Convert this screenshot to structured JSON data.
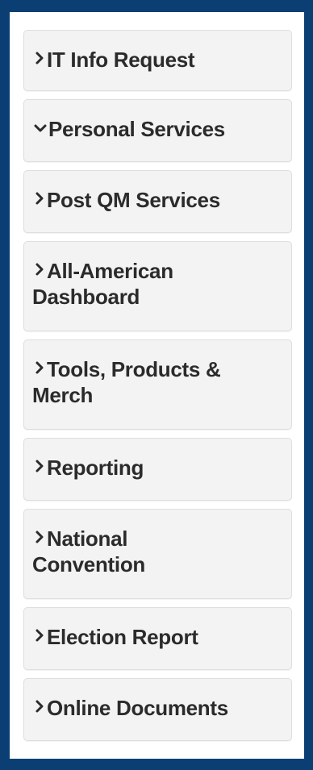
{
  "nav": {
    "items": [
      {
        "label": "IT Info Request",
        "icon": "chevron-right-icon",
        "expanded": false
      },
      {
        "label": "Personal Services",
        "icon": "chevron-down-icon",
        "expanded": true
      },
      {
        "label": "Post QM Services",
        "icon": "chevron-right-icon",
        "expanded": false
      },
      {
        "label": "All-American Dashboard",
        "icon": "chevron-right-icon",
        "expanded": false
      },
      {
        "label": "Tools, Products & Merch",
        "icon": "chevron-right-icon",
        "expanded": false
      },
      {
        "label": "Reporting",
        "icon": "chevron-right-icon",
        "expanded": false
      },
      {
        "label": "National Convention",
        "icon": "chevron-right-icon",
        "expanded": false
      },
      {
        "label": "Election Report",
        "icon": "chevron-right-icon",
        "expanded": false
      },
      {
        "label": "Online Documents",
        "icon": "chevron-right-icon",
        "expanded": false
      }
    ]
  },
  "colors": {
    "frame": "#0b3f73",
    "item_background": "#f3f3f3",
    "item_border": "#dedede",
    "text": "#2b2b2b"
  }
}
